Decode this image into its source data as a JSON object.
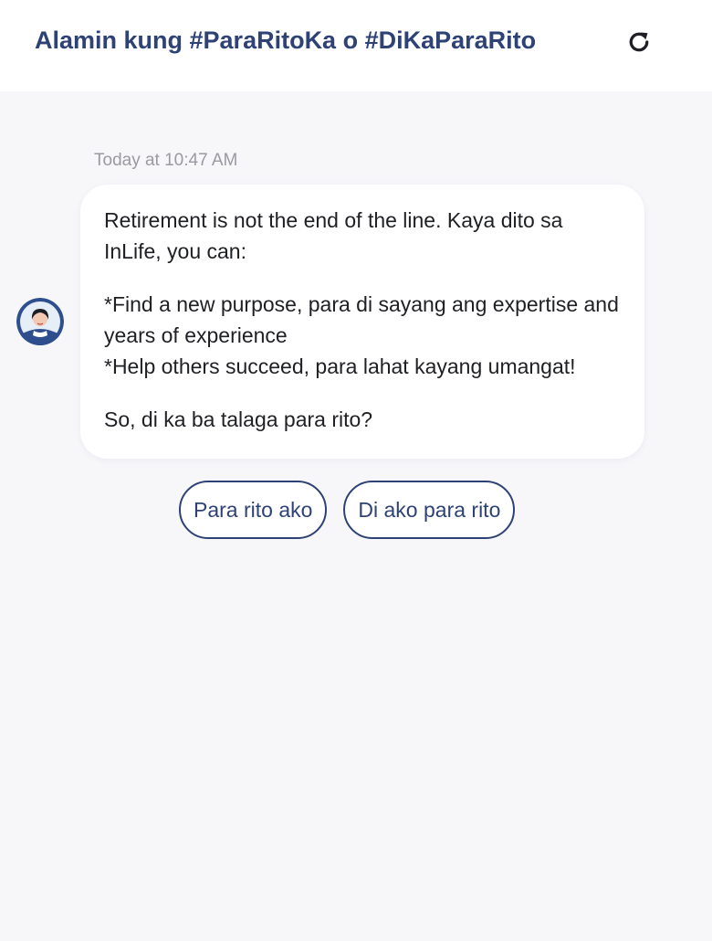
{
  "header": {
    "title": "Alamin kung #ParaRitoKa o #DiKaParaRito",
    "refresh_icon": "refresh-icon"
  },
  "chat": {
    "timestamp": "Today at 10:47 AM",
    "avatar_icon": "bot-avatar",
    "message": {
      "line1": "Retirement is not the end of the line. Kaya dito sa InLife, you can:",
      "line2": "*Find a new purpose, para di sayang ang expertise and years of experience",
      "line3": "*Help others succeed, para lahat kayang umangat!",
      "line4": "So, di ka ba talaga para rito?"
    }
  },
  "quick_replies": [
    {
      "label": "Para rito ako"
    },
    {
      "label": "Di ako para rito"
    }
  ],
  "colors": {
    "accent": "#2f4275",
    "background": "#f7f7fa",
    "bubble": "#ffffff",
    "timestamp": "#9a9ba1"
  }
}
